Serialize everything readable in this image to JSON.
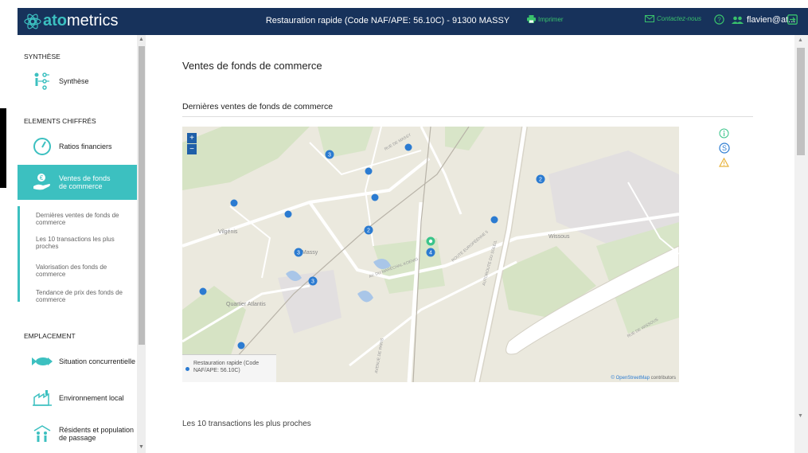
{
  "app": {
    "logo_prefix": "ato",
    "logo_suffix": "metrics",
    "header_title": "Restauration rapide (Code NAF/APE: 56.10C) - 91300 MASSY",
    "print_label": "Imprimer",
    "contact_label": "Contactez-nous",
    "user_label": "flavien@at..."
  },
  "colors": {
    "header_bg": "#17325b",
    "accent": "#3cc0c0",
    "link_green": "#39c16c",
    "marker_blue": "#2b7bd1",
    "marker_green": "#3ac48a"
  },
  "sidebar": {
    "sections": [
      {
        "title": "SYNTHÈSE",
        "items": [
          {
            "label": "Synthèse",
            "icon": "synthesis-icon"
          }
        ]
      },
      {
        "title": "ELEMENTS CHIFFRÉS",
        "items": [
          {
            "label": "Ratios financiers",
            "icon": "gauge-icon"
          },
          {
            "label": "Ventes de fonds de commerce",
            "icon": "euro-hand-icon",
            "active": true
          }
        ],
        "subitems": [
          "Dernières ventes de fonds de commerce",
          "Les 10 transactions les plus proches",
          "Valorisation des fonds de commerce",
          "Tendance de prix des fonds de commerce"
        ]
      },
      {
        "title": "EMPLACEMENT",
        "items": [
          {
            "label": "Situation concurrentielle",
            "icon": "fish-icon"
          },
          {
            "label": "Environnement local",
            "icon": "factory-icon"
          },
          {
            "label": "Résidents et population de passage",
            "icon": "people-icon"
          }
        ]
      }
    ]
  },
  "main": {
    "page_title": "Ventes de fonds de commerce",
    "section_title": "Dernières ventes de fonds de commerce",
    "next_section_title": "Les 10 transactions les plus proches",
    "map": {
      "zoom_in": "+",
      "zoom_out": "−",
      "legend_label": "Restauration rapide (Code NAF/APE: 56.10C)",
      "attribution_link": "© OpenStreetMap",
      "attribution_rest": " contributors",
      "place_labels": [
        "Vilgénis",
        "Massy",
        "Quartier Atlantis",
        "Wissous"
      ],
      "street_labels": [
        "RUE DE MASSY",
        "AUTOROUTE DU SOLEIL",
        "ROUTE EUROPÉENNE 5",
        "AV. DU MARÉCHAL KOENIG",
        "RUE DE WISSOUS",
        "AVENUE DE PARIS"
      ],
      "cluster_counts": [
        "3",
        "2",
        "2",
        "3",
        "3",
        "4",
        "2"
      ]
    },
    "info_icons": [
      "info-icon",
      "dollar-circle-icon",
      "warning-icon"
    ]
  }
}
